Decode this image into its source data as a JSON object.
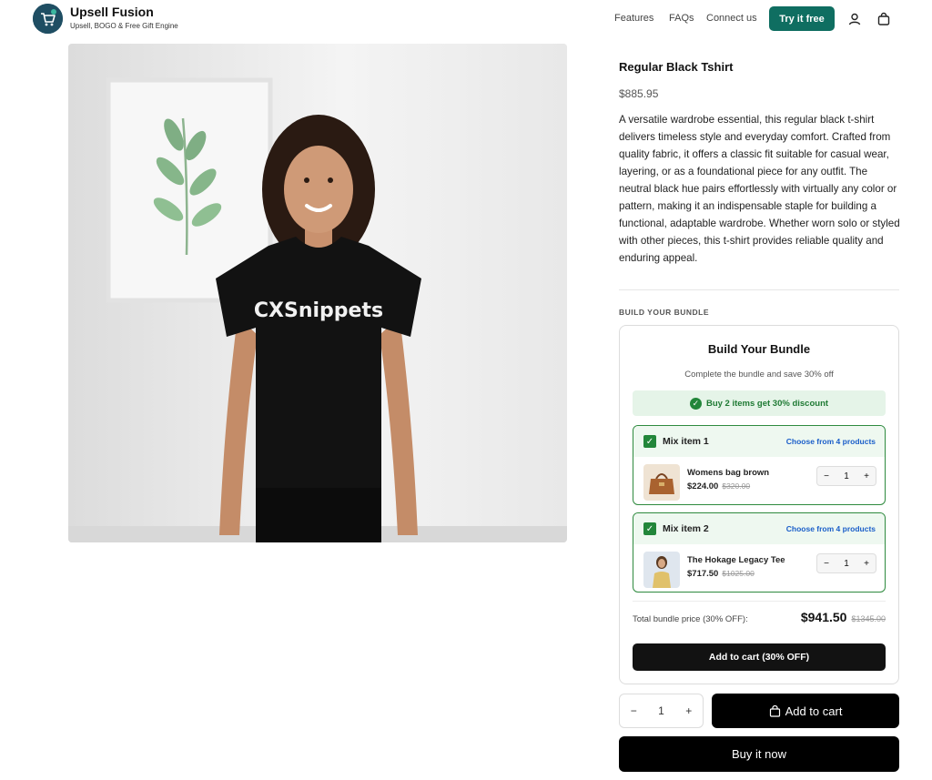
{
  "header": {
    "brand_name": "Upsell Fusion",
    "brand_tagline": "Upsell, BOGO & Free Gift Engine",
    "nav": [
      "Features",
      "FAQs",
      "Connect us"
    ],
    "cta_label": "Try it free",
    "icons": [
      "account-icon",
      "cart-icon"
    ],
    "accent_color": "#0f6e61"
  },
  "product": {
    "image_text": "CXSnippets",
    "title": "Regular Black Tshirt",
    "price": "$885.95",
    "description": "A versatile wardrobe essential, this regular black t-shirt delivers timeless style and everyday comfort. Crafted from quality fabric, it offers a classic fit suitable for casual wear, layering, or as a foundational piece for any outfit. The neutral black hue pairs effortlessly with virtually any color or pattern, making it an indispensable staple for building a functional, adaptable wardrobe. Whether worn solo or styled with other pieces, this t-shirt provides reliable quality and enduring appeal."
  },
  "bundle": {
    "section_heading": "BUILD YOUR BUNDLE",
    "title": "Build Your Bundle",
    "subtitle": "Complete the bundle and save 30% off",
    "banner": "Buy 2 items get 30% discount",
    "items": [
      {
        "label": "Mix item 1",
        "choose": "Choose from 4 products",
        "name": "Womens bag brown",
        "price": "$224.00",
        "compare": "$320.00",
        "qty": "1"
      },
      {
        "label": "Mix item 2",
        "choose": "Choose from 4 products",
        "name": "The Hokage Legacy Tee",
        "price": "$717.50",
        "compare": "$1025.00",
        "qty": "1"
      }
    ],
    "total_label": "Total bundle price (30% OFF):",
    "total_price": "$941.50",
    "total_compare": "$1345.00",
    "cta": "Add to cart (30% OFF)",
    "accent_color": "#22863a"
  },
  "actions": {
    "qty": "1",
    "minus": "−",
    "plus": "+",
    "add_to_cart": "Add to cart",
    "buy_now": "Buy it now"
  }
}
